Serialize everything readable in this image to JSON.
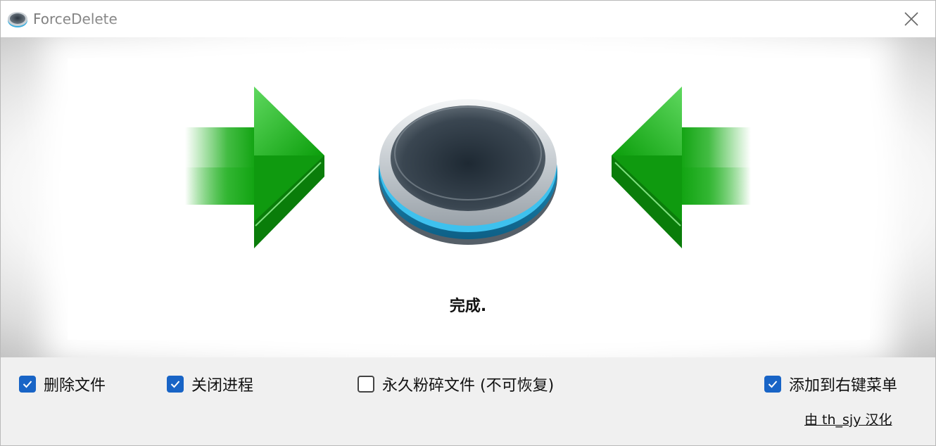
{
  "window": {
    "title": "ForceDelete"
  },
  "status": "完成.",
  "options": {
    "delete_files": {
      "label": "删除文件",
      "checked": true
    },
    "close_processes": {
      "label": "关闭进程",
      "checked": true
    },
    "permanent_shred": {
      "label": "永久粉碎文件 (不可恢复)",
      "checked": false
    },
    "context_menu": {
      "label": "添加到右键菜单",
      "checked": true
    }
  },
  "credit": "由 th_sjy 汉化",
  "colors": {
    "checkbox_accent": "#1864c6",
    "arrow_green": "#14a814",
    "ring_accent": "#3ec1ee"
  },
  "icons": [
    "app-icon",
    "close-icon",
    "arrow-right-icon",
    "hole-icon",
    "arrow-left-icon",
    "checkmark-icon"
  ]
}
